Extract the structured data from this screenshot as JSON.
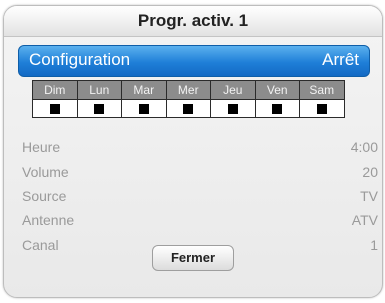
{
  "dialog": {
    "title": "Progr. activ. 1"
  },
  "config": {
    "label": "Configuration",
    "value": "Arrêt"
  },
  "days": [
    "Dim",
    "Lun",
    "Mar",
    "Mer",
    "Jeu",
    "Ven",
    "Sam"
  ],
  "info": [
    {
      "label": "Heure",
      "value": "4:00"
    },
    {
      "label": "Volume",
      "value": "20"
    },
    {
      "label": "Source",
      "value": "TV"
    },
    {
      "label": "Antenne",
      "value": "ATV"
    },
    {
      "label": "Canal",
      "value": "1"
    }
  ],
  "close_button": "Fermer",
  "colors": {
    "accent": "#1f7fd8",
    "header_cell": "#8c8c8c",
    "muted_text": "#9a9a9a"
  }
}
